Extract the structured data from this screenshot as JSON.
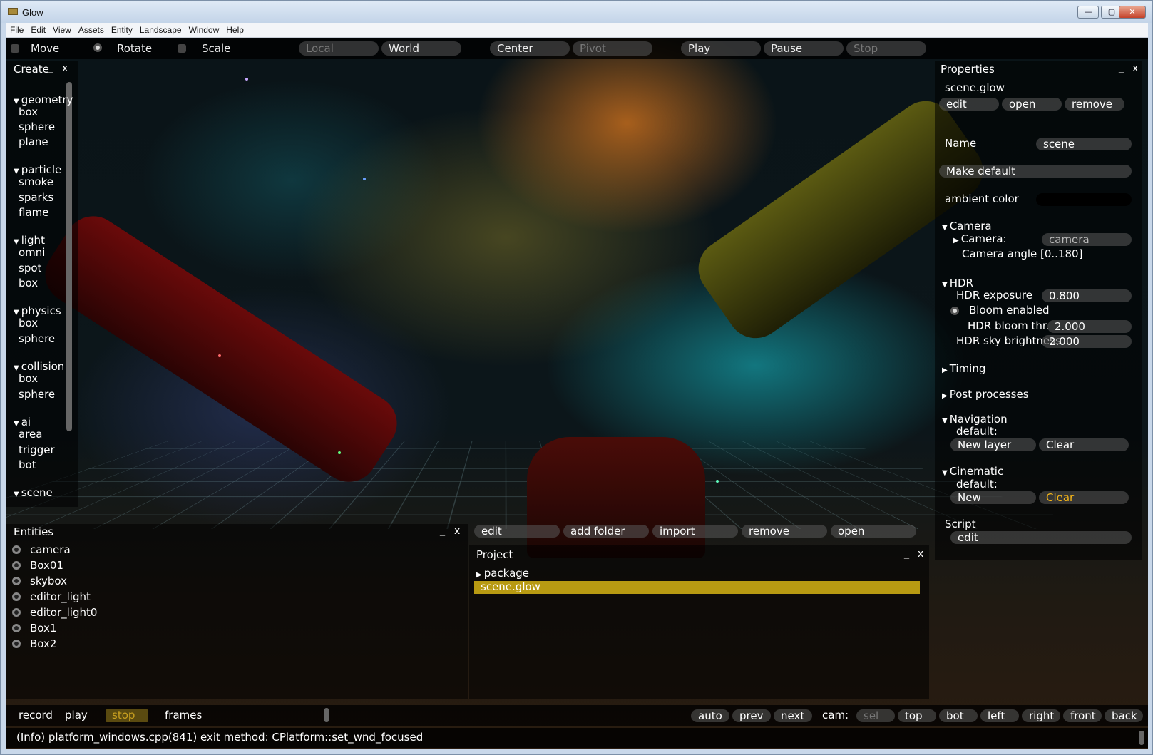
{
  "window": {
    "title": "Glow",
    "min_label": "—",
    "max_label": "▢",
    "close_label": "✕"
  },
  "menu": [
    "File",
    "Edit",
    "View",
    "Assets",
    "Entity",
    "Landscape",
    "Window",
    "Help"
  ],
  "toolbar": {
    "move": "Move",
    "rotate": "Rotate",
    "scale": "Scale",
    "local": "Local",
    "world": "World",
    "center": "Center",
    "pivot": "Pivot",
    "play": "Play",
    "pause": "Pause",
    "stop": "Stop"
  },
  "create": {
    "title": "Create",
    "min": "_",
    "close": "x",
    "groups": [
      {
        "name": "geometry",
        "items": [
          "box",
          "sphere",
          "plane"
        ]
      },
      {
        "name": "particle",
        "items": [
          "smoke",
          "sparks",
          "flame"
        ]
      },
      {
        "name": "light",
        "items": [
          "omni",
          "spot",
          "box"
        ]
      },
      {
        "name": "physics",
        "items": [
          "box",
          "sphere"
        ]
      },
      {
        "name": "collision",
        "items": [
          "box",
          "sphere"
        ]
      },
      {
        "name": "ai",
        "items": [
          "area",
          "trigger",
          "bot"
        ]
      },
      {
        "name": "scene",
        "items": []
      }
    ]
  },
  "properties": {
    "title": "Properties",
    "min": "_",
    "close": "x",
    "file": "scene.glow",
    "buttons": [
      "edit",
      "open",
      "remove"
    ],
    "name_label": "Name",
    "name_value": "scene",
    "make_default": "Make default",
    "ambient_label": "ambient color",
    "camera_section": "Camera",
    "camera_label": "Camera:",
    "camera_value": "camera",
    "camera_angle": "Camera angle [0..180]",
    "hdr_section": "HDR",
    "hdr_exposure_label": "HDR exposure",
    "hdr_exposure_value": "0.800",
    "bloom_label": "Bloom enabled",
    "bloom_thr_label": "HDR bloom thr.",
    "bloom_thr_value": "2.000",
    "sky_label": "HDR sky brightness",
    "sky_value": "2.000",
    "timing": "Timing",
    "post": "Post processes",
    "navigation": "Navigation",
    "nav_default": "default:",
    "nav_new": "New layer",
    "nav_clear": "Clear",
    "cinematic": "Cinematic",
    "cin_default": "default:",
    "cin_new": "New",
    "cin_clear": "Clear",
    "script": "Script",
    "script_edit": "edit",
    "accent": "#f3b419"
  },
  "entities": {
    "title": "Entities",
    "min": "_",
    "close": "x",
    "items": [
      "camera",
      "Box01",
      "skybox",
      "editor_light",
      "editor_light0",
      "Box1",
      "Box2"
    ]
  },
  "project_toolbar": [
    "edit",
    "add folder",
    "import",
    "remove",
    "open"
  ],
  "project": {
    "title": "Project",
    "min": "_",
    "close": "x",
    "package": "package",
    "selected": "scene.glow",
    "highlight": "#b89a12"
  },
  "timeline": {
    "record": "record",
    "play": "play",
    "stop": "stop",
    "frames": "frames",
    "auto": "auto",
    "prev": "prev",
    "next": "next",
    "cam": "cam:",
    "sel": "sel",
    "top": "top",
    "bot": "bot",
    "left": "left",
    "right": "right",
    "front": "front",
    "back": "back"
  },
  "status": "(Info) platform_windows.cpp(841) exit method: CPlatform::set_wnd_focused"
}
